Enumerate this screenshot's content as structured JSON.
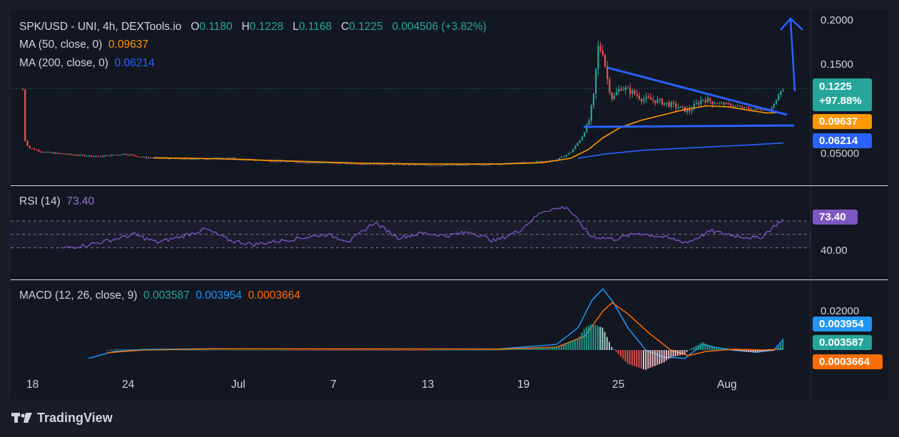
{
  "header": {
    "symbol": "SPK/USD - UNI, 4h, DEXTools.io",
    "o_label": "O",
    "o_value": "0.1180",
    "h_label": "H",
    "h_value": "0.1228",
    "l_label": "L",
    "l_value": "0.1168",
    "c_label": "C",
    "c_value": "0.1225",
    "change": "0.004506 (+3.82%)"
  },
  "ma50": {
    "label": "MA (50, close, 0)",
    "value": "0.09637"
  },
  "ma200": {
    "label": "MA (200, close, 0)",
    "value": "0.06214"
  },
  "rsi": {
    "label": "RSI (14)",
    "value": "73.40"
  },
  "macd": {
    "label": "MACD (12, 26, close, 9)",
    "hist": "0.003587",
    "macd": "0.003954",
    "signal": "0.0003664"
  },
  "price_axis": {
    "ticks": [
      "0.2000",
      "0.1500",
      "0.05000"
    ]
  },
  "rsi_axis": {
    "ticks": [
      "40.00"
    ]
  },
  "macd_axis": {
    "ticks": [
      "0.02000"
    ]
  },
  "badges": {
    "price": "0.1225",
    "change_pct": "+97.88%",
    "ma50": "0.09637",
    "ma200": "0.06214",
    "rsi": "73.40",
    "macd": "0.003954",
    "hist": "0.003587",
    "signal": "0.0003664"
  },
  "x_ticks": [
    "18",
    "24",
    "Jul",
    "7",
    "13",
    "19",
    "25",
    "Aug"
  ],
  "branding": "TradingView",
  "colors": {
    "bg": "#131722",
    "up": "#26a69a",
    "down": "#ef5350",
    "ma50": "#ff9800",
    "ma200": "#2962ff",
    "rsi": "#7e57c2",
    "macd": "#2196f3",
    "signal": "#ff6d00",
    "annotation": "#2962ff"
  },
  "chart_data": [
    {
      "type": "candlestick",
      "title": "SPK/USD - UNI, 4h, DEXTools.io",
      "x": [
        "18",
        "24",
        "Jul",
        "7",
        "13",
        "19",
        "25",
        "Aug"
      ],
      "ylim": [
        0.03,
        0.2
      ],
      "close_price": [
        0.067,
        0.058,
        0.052,
        0.056,
        0.046,
        0.043,
        0.04,
        0.038,
        0.038,
        0.039,
        0.04,
        0.046,
        0.072,
        0.175,
        0.112,
        0.122,
        0.105,
        0.099,
        0.11,
        0.108,
        0.103,
        0.101,
        0.1225
      ],
      "series": [
        {
          "name": "MA (50, close, 0)",
          "last": 0.09637
        },
        {
          "name": "MA (200, close, 0)",
          "last": 0.06214
        }
      ],
      "annotations": [
        "descending trendline",
        "horizontal support",
        "upward arrow"
      ]
    },
    {
      "type": "line",
      "title": "RSI (14)",
      "ylim": [
        20,
        100
      ],
      "values": [
        29,
        34,
        41,
        50,
        38,
        47,
        58,
        41,
        35,
        40,
        45,
        50,
        40,
        68,
        45,
        52,
        48,
        54,
        40,
        55,
        85,
        91,
        47,
        43,
        52,
        46,
        38,
        55,
        48,
        44,
        73.4
      ],
      "last": 73.4
    },
    {
      "type": "line",
      "title": "MACD (12, 26, close, 9)",
      "ylim": [
        -0.008,
        0.03
      ],
      "series": [
        {
          "name": "MACD",
          "last": 0.003954
        },
        {
          "name": "Signal",
          "last": 0.0003664
        },
        {
          "name": "Histogram",
          "last": 0.003587
        }
      ]
    }
  ]
}
